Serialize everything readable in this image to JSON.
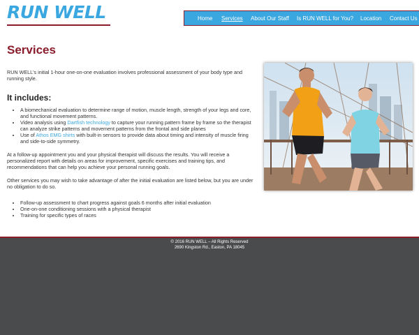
{
  "logo": {
    "text": "RUN WELL"
  },
  "nav": {
    "items": [
      {
        "label": "Home"
      },
      {
        "label": "Services"
      },
      {
        "label": "About Our Staff"
      },
      {
        "label": "Is RUN WELL for You?"
      },
      {
        "label": "Location"
      },
      {
        "label": "Contact Us"
      }
    ],
    "active": "Services"
  },
  "main": {
    "title": "Services",
    "intro": "RUN WELL's initial 1-hour one-on-one evaluation involves professional assessment of your body type and running style.",
    "includes_heading": "It includes:",
    "includes": [
      {
        "text": "A biomechanical evaluation to determine range of motion, muscle length, strength of your legs and core, and functional movement patterns."
      },
      {
        "before": "Video analysis using ",
        "link": "Dartfish technology",
        "after": " to capture your running pattern frame by frame so the therapist can analyze strike patterns and movement patterns from the frontal and side planes"
      },
      {
        "before": "Use of ",
        "link": "Athos EMG shirts",
        "after": " with built-in sensors to provide data about timing and intensity of muscle firing and side-to-side symmetry."
      }
    ],
    "followup": "At a follow-up appointment you and your physical therapist will discuss the results. You will receive a personalized report with details on areas for improvement, specific exercises and training tips, and recommendations that can help you achieve your personal running goals.",
    "other_services_intro": "Other services you may wish to take advantage of after the initial evaluation are listed below, but you are under no obligation to do so.",
    "other_services": [
      "Follow-up assessment to chart progress against goals 6 months after initial evaluation",
      "One-on-one conditioning sessions with a physical therapist",
      "Training for specific types of races"
    ]
  },
  "footer": {
    "copyright": "© 2016 RUN WELL – All Rights Reserved",
    "address": "2690 Kingston Rd., Easton, PA 18045"
  },
  "colors": {
    "accent": "#3aa7e0",
    "brand_dark": "#8a1c2b",
    "footer_bg": "#4a4b4d"
  }
}
